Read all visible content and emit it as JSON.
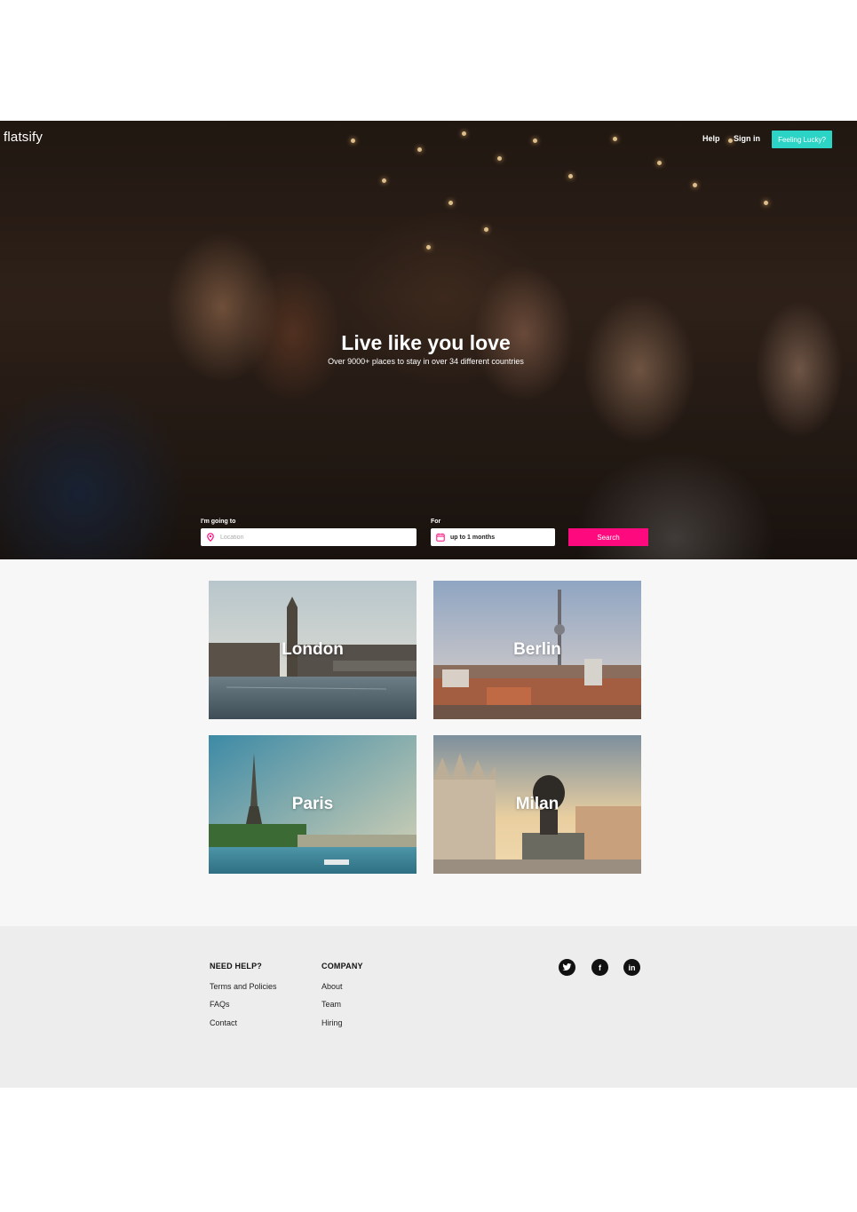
{
  "brand": {
    "logo": "flatsify"
  },
  "nav": {
    "help": "Help",
    "sign_in": "Sign in",
    "lucky": "Feeling Lucky?"
  },
  "hero": {
    "title": "Live like you love",
    "subtitle": "Over 9000+ places to stay in over 34 different countries"
  },
  "search": {
    "going_label": "I'm going to",
    "location_placeholder": "Location",
    "for_label": "For",
    "duration_value": "up to 1 months",
    "button": "Search",
    "accent_color": "#ff0a7e"
  },
  "cities": [
    {
      "name": "London"
    },
    {
      "name": "Berlin"
    },
    {
      "name": "Paris"
    },
    {
      "name": "Milan"
    }
  ],
  "footer": {
    "help_heading": "NEED HELP?",
    "help_links": [
      "Terms and Policies",
      "FAQs",
      "Contact"
    ],
    "company_heading": "COMPANY",
    "company_links": [
      "About",
      "Team",
      "Hiring"
    ],
    "social": [
      {
        "icon": "twitter-icon",
        "glyph": "t"
      },
      {
        "icon": "facebook-icon",
        "glyph": "f"
      },
      {
        "icon": "linkedin-icon",
        "glyph": "in"
      }
    ]
  },
  "colors": {
    "lucky_button": "#2bd4c5",
    "search_button": "#ff0a7e",
    "footer_bg": "#ededed"
  }
}
